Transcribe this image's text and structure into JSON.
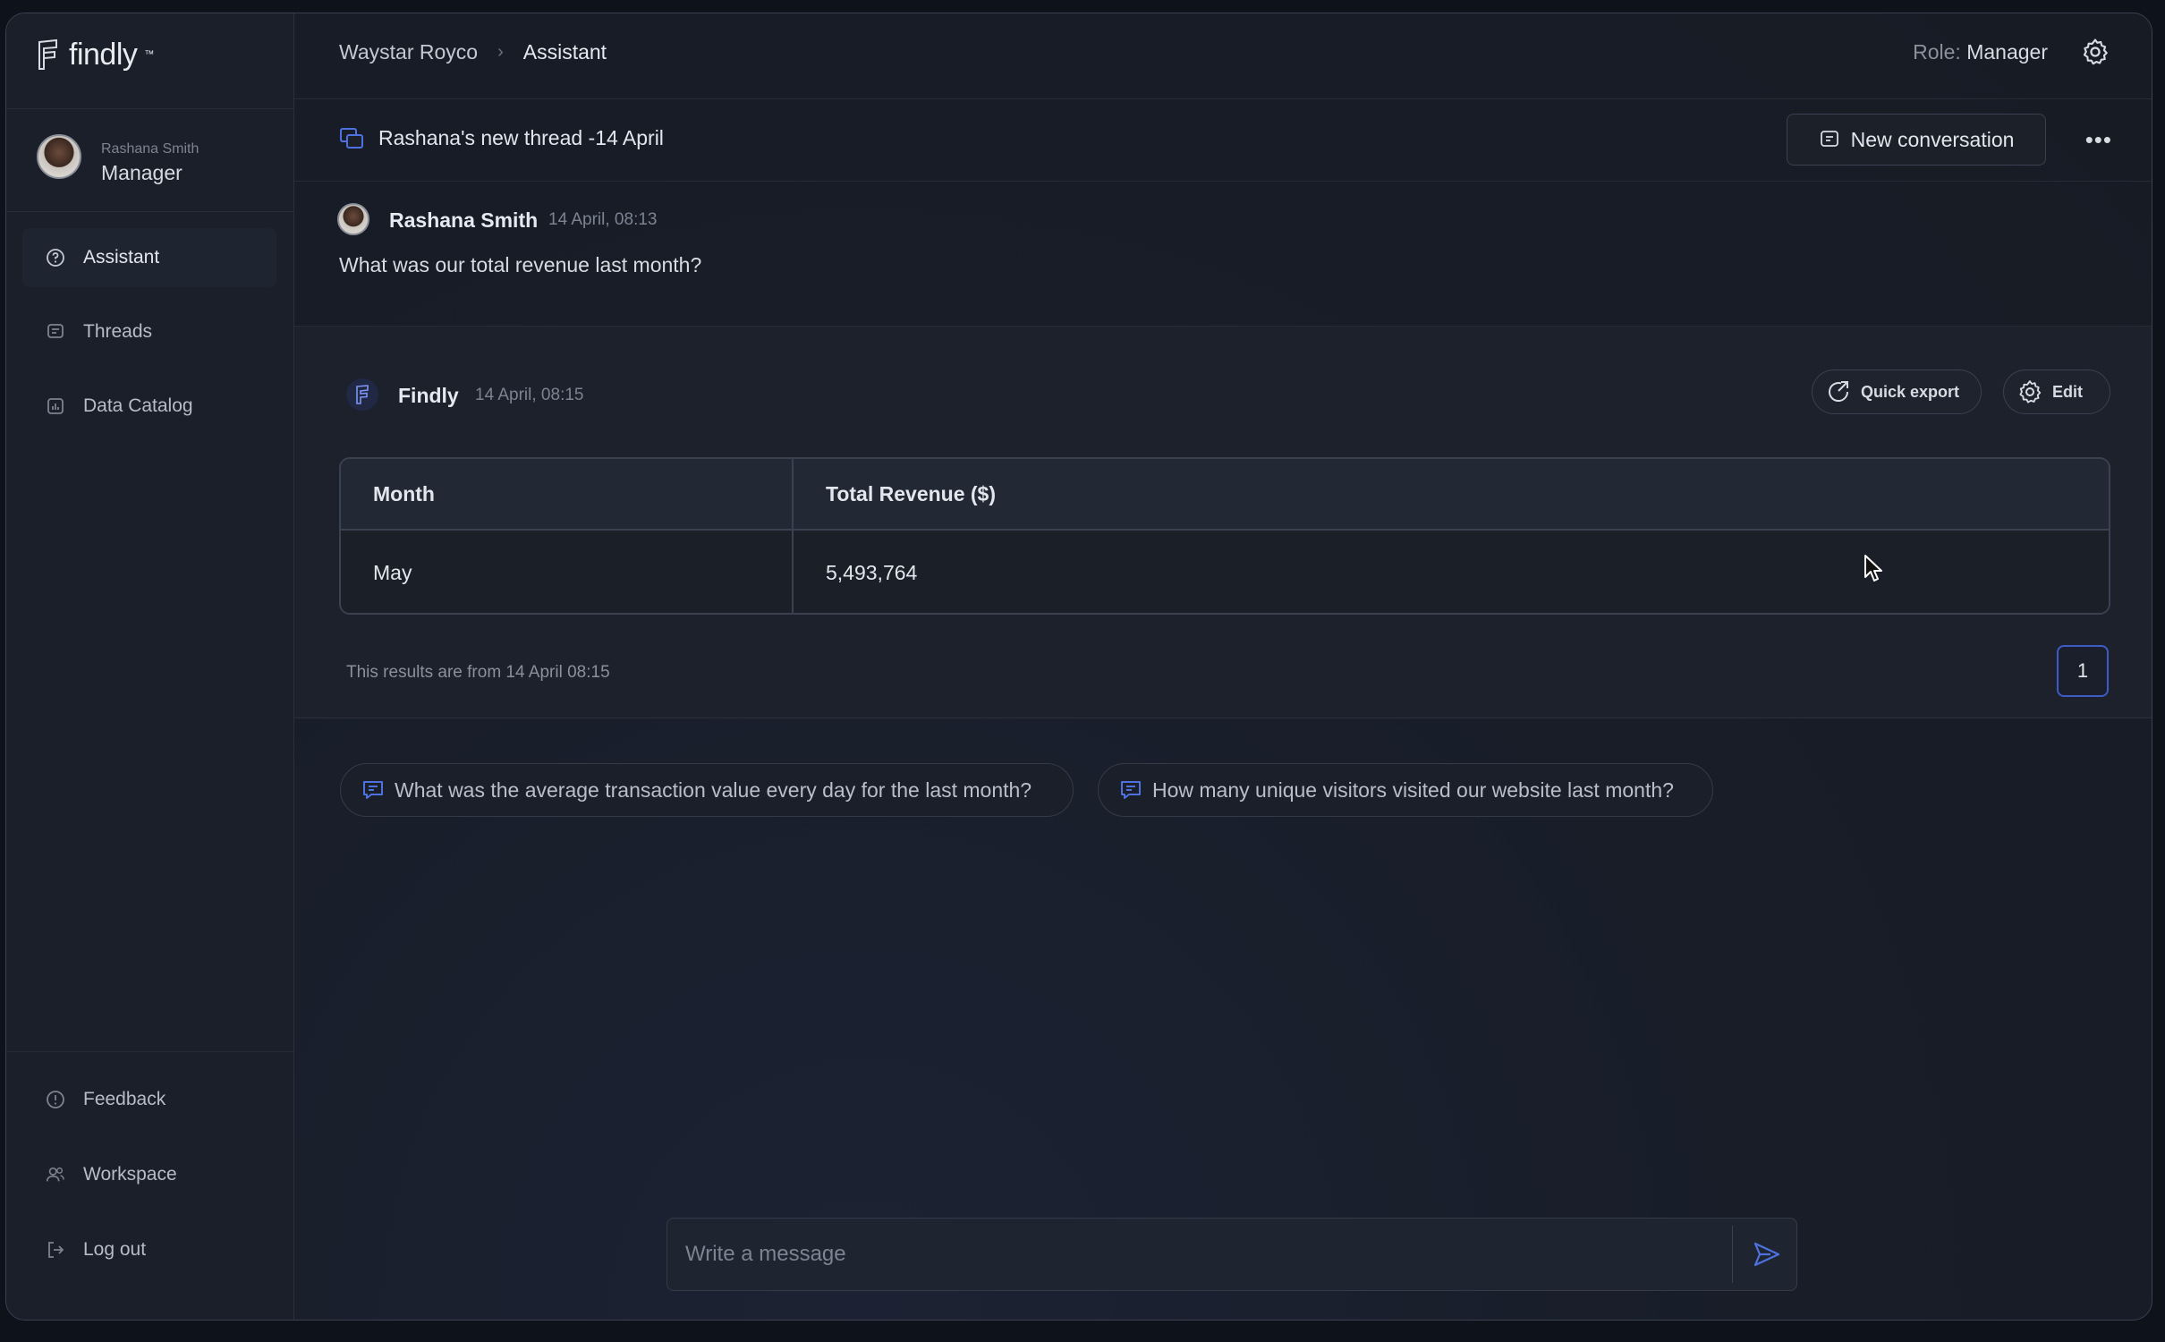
{
  "app": {
    "logo_text": "findly"
  },
  "user": {
    "name": "Rashana Smith",
    "role": "Manager"
  },
  "sidebar": {
    "items": [
      {
        "label": "Assistant",
        "icon": "help-circle-icon",
        "active": true
      },
      {
        "label": "Threads",
        "icon": "chat-icon",
        "active": false
      },
      {
        "label": "Data Catalog",
        "icon": "chart-icon",
        "active": false
      }
    ],
    "bottom_items": [
      {
        "label": "Feedback",
        "icon": "feedback-icon"
      },
      {
        "label": "Workspace",
        "icon": "users-icon"
      },
      {
        "label": "Log out",
        "icon": "logout-icon"
      }
    ]
  },
  "header": {
    "breadcrumb": [
      "Waystar Royco",
      "Assistant"
    ],
    "role_label": "Role:",
    "role_value": "Manager"
  },
  "thread": {
    "title": "Rashana's new thread -14 April",
    "new_conversation_label": "New conversation",
    "more_label": "•••"
  },
  "user_message": {
    "author": "Rashana Smith",
    "time": "14 April, 08:13",
    "text": "What was our total revenue last month?"
  },
  "assistant_message": {
    "author": "Findly",
    "time": "14 April, 08:15",
    "quick_export_label": "Quick export",
    "edit_label": "Edit",
    "table": {
      "headers": [
        "Month",
        "Total Revenue ($)"
      ],
      "rows": [
        [
          "May",
          "5,493,764"
        ]
      ]
    },
    "result_note": "This results are from 14 April 08:15",
    "page": "1"
  },
  "suggestions": [
    "What was the average transaction value every day for the last month?",
    "How many unique visitors visited our website last month?"
  ],
  "composer": {
    "placeholder": "Write a message"
  },
  "colors": {
    "accent": "#3d5bc4",
    "background": "#171b24",
    "sidebar": "#1a1f29"
  }
}
